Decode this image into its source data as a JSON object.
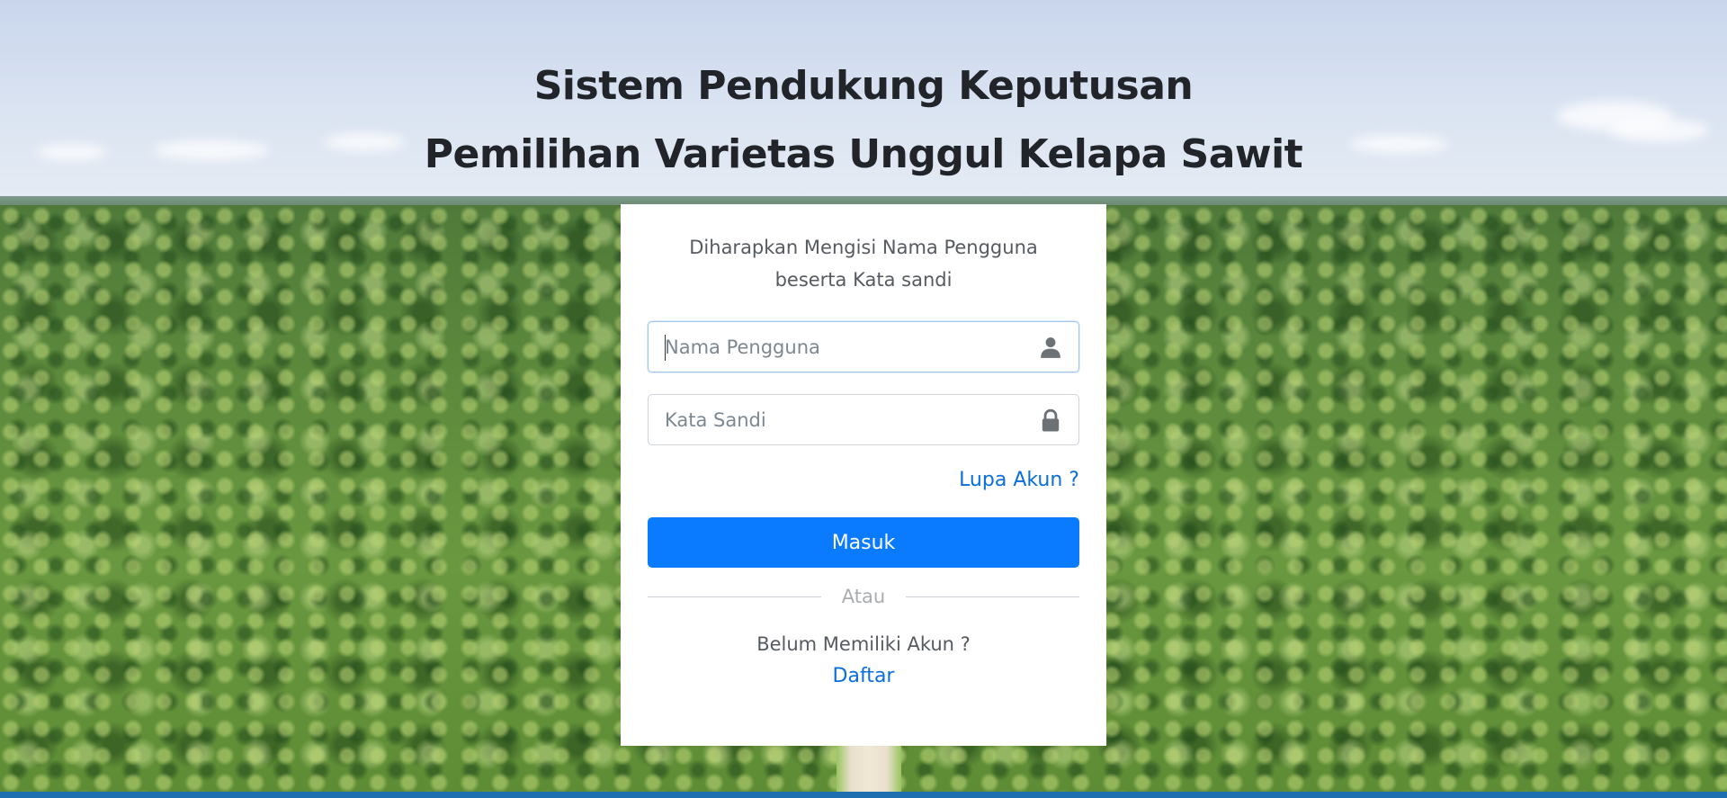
{
  "header": {
    "title_line1": "Sistem Pendukung Keputusan",
    "title_line2": "Pemilihan Varietas Unggul Kelapa Sawit"
  },
  "login": {
    "intro_line1": "Diharapkan Mengisi Nama Pengguna",
    "intro_line2": "beserta Kata sandi",
    "username": {
      "placeholder": "Nama Pengguna",
      "value": "",
      "icon": "user-icon"
    },
    "password": {
      "placeholder": "Kata Sandi",
      "value": "",
      "icon": "lock-icon"
    },
    "forgot_link": "Lupa Akun ?",
    "submit_label": "Masuk",
    "divider_text": "Atau",
    "signup_question": "Belum Memiliki Akun ?",
    "signup_link": "Daftar"
  },
  "colors": {
    "primary": "#0a7bff",
    "link": "#0a6fdc",
    "card": "#ffffff"
  }
}
